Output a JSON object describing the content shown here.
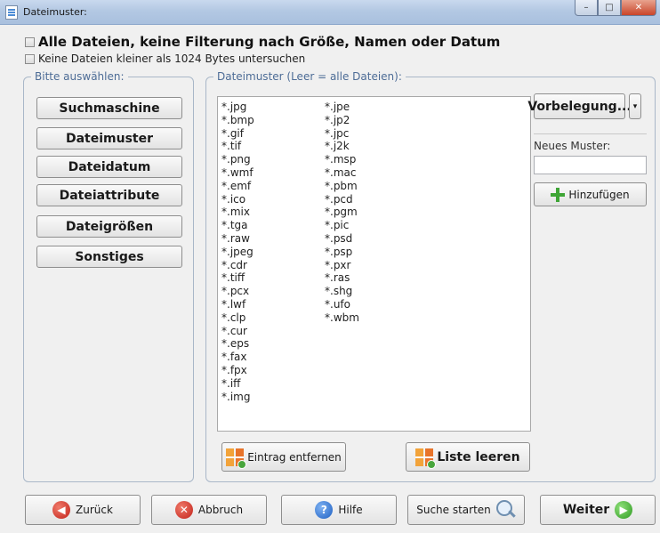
{
  "window": {
    "title": "Dateimuster:",
    "min_label": "–",
    "max_label": "□",
    "close_label": "✕"
  },
  "options": {
    "all_files_label": "Alle Dateien, keine Filterung nach Größe, Namen oder Datum",
    "min_size_label": "Keine Dateien kleiner als 1024 Bytes untersuchen"
  },
  "left_panel": {
    "legend": "Bitte auswählen:",
    "buttons": [
      "Suchmaschine",
      "Dateimuster",
      "Dateidatum",
      "Dateiattribute",
      "Dateigrößen",
      "Sonstiges"
    ]
  },
  "main_panel": {
    "legend": "Dateimuster (Leer = alle Dateien):",
    "patterns_col1": [
      "*.jpg",
      "*.bmp",
      "*.gif",
      "*.tif",
      "*.png",
      "*.wmf",
      "*.emf",
      "*.ico",
      "*.mix",
      "*.tga",
      "*.raw",
      "*.jpeg",
      "*.cdr",
      "*.tiff",
      "*.pcx",
      "*.lwf",
      "*.clp",
      "*.cur",
      "*.eps",
      "*.fax",
      "*.fpx",
      "*.iff",
      "*.img"
    ],
    "patterns_col2": [
      "*.jpe",
      "*.jp2",
      "*.jpc",
      "*.j2k",
      "*.msp",
      "*.mac",
      "*.pbm",
      "*.pcd",
      "*.pgm",
      "*.pic",
      "*.psd",
      "*.psp",
      "*.pxr",
      "*.ras",
      "*.shg",
      "*.ufo",
      "*.wbm"
    ],
    "preset_label": "Vorbelegung...",
    "preset_arrow": "▾",
    "new_pattern_label": "Neues Muster:",
    "new_pattern_value": "",
    "add_label": "Hinzufügen",
    "remove_label": "Eintrag entfernen",
    "clear_label": "Liste leeren"
  },
  "bottom_bar": {
    "back_label": "Zurück",
    "cancel_label": "Abbruch",
    "help_label": "Hilfe",
    "search_label": "Suche starten",
    "next_label": "Weiter"
  },
  "colors": {
    "legend_text": "#4d6c96",
    "accent_green": "#3fa536",
    "accent_orange": "#f2a33a"
  }
}
